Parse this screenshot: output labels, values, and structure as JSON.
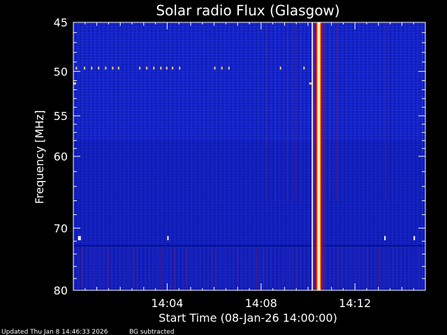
{
  "chart_data": {
    "type": "heatmap",
    "title": "Solar radio Flux (Glasgow)",
    "xlabel": "Start Time (08-Jan-26 14:00:00)",
    "ylabel": "Frequency [MHz]",
    "x_axis": {
      "unit": "minutes",
      "range_minutes": [
        0,
        15
      ],
      "ticks": [
        {
          "value_minutes": 4,
          "label": "14:04"
        },
        {
          "value_minutes": 8,
          "label": "14:08"
        },
        {
          "value_minutes": 12,
          "label": "14:12"
        }
      ]
    },
    "y_axis": {
      "scale": "log",
      "inverted": true,
      "range_mhz": [
        45,
        80
      ],
      "ticks": [
        {
          "value": 45,
          "label": "45"
        },
        {
          "value": 50,
          "label": "50"
        },
        {
          "value": 55,
          "label": "55"
        },
        {
          "value": 60,
          "label": "60"
        },
        {
          "value": 70,
          "label": "70"
        },
        {
          "value": 80,
          "label": "80"
        }
      ]
    },
    "background_color": "#1424c8",
    "features": {
      "burst": {
        "time_minutes": 10.45,
        "freq_range_mhz": [
          45,
          80
        ],
        "intensity": "high"
      },
      "weak_lines_minutes": [
        8.2,
        8.6,
        9.1,
        9.4,
        9.7,
        10.9,
        11.2,
        13.3
      ]
    }
  },
  "footer": {
    "updated": "Updated Thu Jan  8 14:46:33 2026",
    "note": "BG subtracted"
  },
  "colors": {
    "background": "#000000",
    "text": "#ffffff",
    "spectrum_base": "#1424c8",
    "burst_core": "#ffff80",
    "burst_edge": "#ff2000"
  }
}
